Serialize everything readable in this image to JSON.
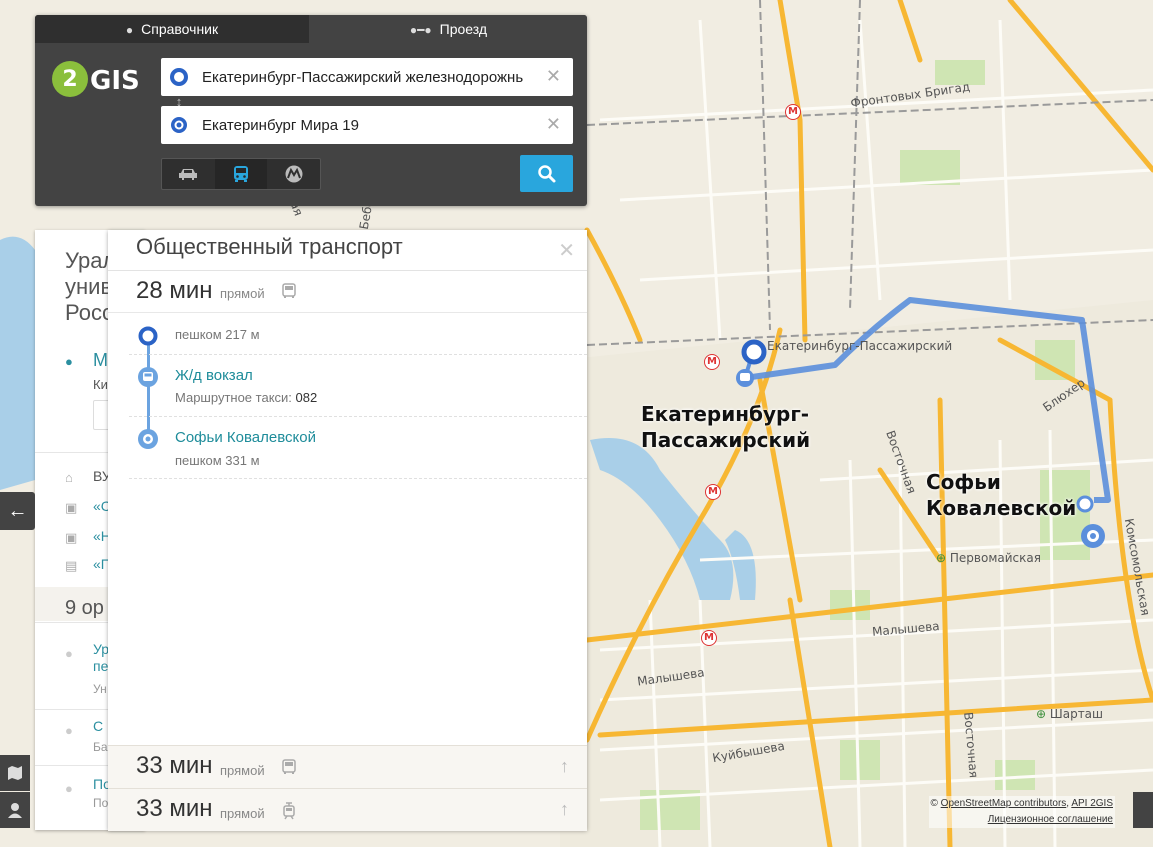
{
  "header": {
    "tab_directory": "Справочник",
    "tab_route": "Проезд",
    "logo_text": "2GIS"
  },
  "route_form": {
    "from_value": "Екатеринбург-Пассажирский железнодорожнь",
    "to_value": "Екатеринбург Мира 19",
    "modes": [
      {
        "name": "car-icon",
        "active": false
      },
      {
        "name": "bus-icon",
        "active": true
      },
      {
        "name": "metro-icon",
        "active": false
      }
    ]
  },
  "background_panel": {
    "title_lines": [
      "Урал",
      "унив",
      "Росс"
    ],
    "address_link": "М",
    "address_sub": "Ки",
    "row_a": "ВУ",
    "row_b": "«С",
    "row_c": "«Н",
    "row_d": "«П",
    "orgs_title": "9 ор",
    "items": [
      {
        "line1": "Ур",
        "line2": "пе",
        "line3": "Ун"
      },
      {
        "line1": "С",
        "line2": "Ба"
      },
      {
        "line1": "По",
        "line2": "По"
      }
    ]
  },
  "transit_panel": {
    "title": "Общественный транспорт",
    "routes": [
      {
        "time": "28 мин",
        "kind": "прямой",
        "icon": "bus-icon"
      },
      {
        "time": "33 мин",
        "kind": "прямой",
        "icon": "bus-icon"
      },
      {
        "time": "33 мин",
        "kind": "прямой",
        "icon": "tram-icon"
      }
    ],
    "steps": {
      "walk_start": "пешком 217 м",
      "stop_from": "Ж/д вокзал",
      "minibus_prefix": "Маршрутное такси:",
      "minibus_number": "082",
      "stop_to": "Софьи Ковалевской",
      "walk_end": "пешком 331 м"
    }
  },
  "map": {
    "big_labels": {
      "start_line1": "Екатеринбург-",
      "start_line2": "Пассажирский",
      "end_line1": "Софьи",
      "end_line2": "Ковалевской"
    },
    "streets": {
      "frontovykh": "Фронтовых Бригад",
      "ekb_pass": "Екатеринбург-Пассажирский",
      "blukher": "Блюхер",
      "vostochnaya_top": "Восточная",
      "vostochnaya_bottom": "Восточная",
      "komsomolskaya": "Комсомольская",
      "pervomayskaya": "Первомайская",
      "malysheva_left": "Малышева",
      "malysheva_right": "Малышева",
      "kuybysheva": "Куйбышева",
      "shartash": "Шарташ",
      "bebelya": "Бебеля",
      "krasnaya": "ская"
    },
    "metro_letter": "М",
    "route_color": "#5b8fdc"
  },
  "footer": {
    "attribution_prefix": "©",
    "osm_link": "OpenStreetMap contributors",
    "api_link": "API 2GIS",
    "license": "Лицензионное соглашение"
  }
}
